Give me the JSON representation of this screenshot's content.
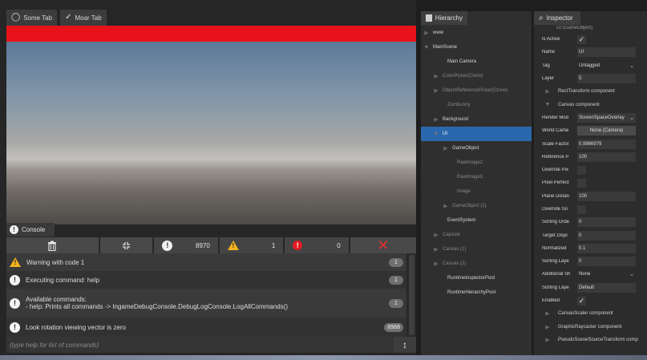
{
  "tabs": [
    {
      "label": "Some Tab",
      "icon": "circle-icon"
    },
    {
      "label": "Moar Tab",
      "icon": "checkmark-icon"
    }
  ],
  "colors": {
    "red_bar": "#e8121a",
    "selection": "#2a68ad",
    "warning": "#f3b21d",
    "error": "#e41b23"
  },
  "console": {
    "tab_label": "Console",
    "filters": {
      "info_count": "8970",
      "warning_count": "1",
      "error_count": "0"
    },
    "logs": [
      {
        "type": "warning",
        "message": "Warning with code 1",
        "count": "1"
      },
      {
        "type": "info",
        "message": "Executing command: help",
        "count": "1"
      },
      {
        "type": "info",
        "message": "Available commands:\n- help: Prints all commands -> IngameDebugConsole.DebugLogConsole.LogAllCommands()",
        "count": "1"
      },
      {
        "type": "info",
        "message": "Look rotation viewing vector is zero",
        "count": "8968"
      }
    ],
    "input_placeholder": "(type help for list of commands)"
  },
  "hierarchy": {
    "tab_label": "Hierarchy",
    "items": [
      {
        "label": "www",
        "indent": 0,
        "arrow": "right",
        "style": "normal"
      },
      {
        "label": "MainScene",
        "indent": 0,
        "arrow": "down",
        "style": "normal"
      },
      {
        "label": "Main Camera",
        "indent": 1,
        "arrow": "none",
        "style": "normal"
      },
      {
        "label": "ColorPicker(Clone)",
        "indent": 1,
        "arrow": "right",
        "style": "dim"
      },
      {
        "label": "ObjectReferencePicker(Clone)",
        "indent": 1,
        "arrow": "right",
        "style": "dim"
      },
      {
        "label": "Zombunny",
        "indent": 1,
        "arrow": "none",
        "style": "dim"
      },
      {
        "label": "Background",
        "indent": 1,
        "arrow": "right",
        "style": "normal"
      },
      {
        "label": "UI",
        "indent": 1,
        "arrow": "down",
        "style": "sel"
      },
      {
        "label": "GameObject",
        "indent": 2,
        "arrow": "right",
        "style": "normal"
      },
      {
        "label": "RawImage2",
        "indent": 2,
        "arrow": "none",
        "style": "dim"
      },
      {
        "label": "RawImage3",
        "indent": 2,
        "arrow": "none",
        "style": "dim"
      },
      {
        "label": "Image",
        "indent": 2,
        "arrow": "none",
        "style": "dim"
      },
      {
        "label": "GameObject (1)",
        "indent": 2,
        "arrow": "right",
        "style": "dim"
      },
      {
        "label": "EventSystem",
        "indent": 1,
        "arrow": "none",
        "style": "normal"
      },
      {
        "label": "Capsule",
        "indent": 1,
        "arrow": "right",
        "style": "dim"
      },
      {
        "label": "Canvas (1)",
        "indent": 1,
        "arrow": "right",
        "style": "dim"
      },
      {
        "label": "Canvas (2)",
        "indent": 1,
        "arrow": "right",
        "style": "dim"
      },
      {
        "label": "RuntimeInspectorPool",
        "indent": 1,
        "arrow": "none",
        "style": "normal"
      },
      {
        "label": "RuntimeHierarchyPool",
        "indent": 1,
        "arrow": "none",
        "style": "normal"
      }
    ]
  },
  "inspector": {
    "tab_label": "Inspector",
    "title": "UI (GameObject)",
    "rows": [
      {
        "kind": "check",
        "label": "Is Active",
        "value": "✓"
      },
      {
        "kind": "field",
        "label": "Name",
        "value": "UI"
      },
      {
        "kind": "dropdown",
        "label": "Tag",
        "value": "Untagged"
      },
      {
        "kind": "field",
        "label": "Layer",
        "value": "5"
      },
      {
        "kind": "section",
        "label": "RectTransform component",
        "arrow": "right"
      },
      {
        "kind": "section",
        "label": "Canvas component",
        "arrow": "down"
      },
      {
        "kind": "dropdown",
        "label": "Render Mod",
        "value": "ScreenSpaceOverlay",
        "boxed": true
      },
      {
        "kind": "button",
        "label": "World Came",
        "value": "None (Camera)"
      },
      {
        "kind": "field",
        "label": "Scale Factor",
        "value": "0.9986979"
      },
      {
        "kind": "field",
        "label": "Reference P",
        "value": "100"
      },
      {
        "kind": "check",
        "label": "Override Pix",
        "value": ""
      },
      {
        "kind": "check",
        "label": "Pixel Perfect",
        "value": ""
      },
      {
        "kind": "field",
        "label": "Plane Distan",
        "value": "100"
      },
      {
        "kind": "check",
        "label": "Override So",
        "value": ""
      },
      {
        "kind": "field",
        "label": "Sorting Orde",
        "value": "0"
      },
      {
        "kind": "field",
        "label": "Target Displ",
        "value": "0"
      },
      {
        "kind": "field",
        "label": "Normalized",
        "value": "0.1"
      },
      {
        "kind": "field",
        "label": "Sorting Laye",
        "value": "0"
      },
      {
        "kind": "dropdown",
        "label": "Additional Sh",
        "value": "None"
      },
      {
        "kind": "field",
        "label": "Sorting Laye",
        "value": "Default"
      },
      {
        "kind": "check",
        "label": "Enabled",
        "value": "✓"
      },
      {
        "kind": "section",
        "label": "CanvasScaler component",
        "arrow": "right"
      },
      {
        "kind": "section",
        "label": "GraphicRaycaster component",
        "arrow": "right"
      },
      {
        "kind": "section",
        "label": "PseudoSceneSourceTransform comp",
        "arrow": "right"
      }
    ]
  }
}
